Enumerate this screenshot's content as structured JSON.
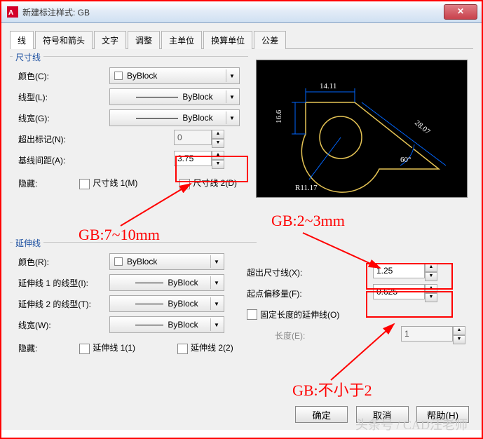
{
  "window": {
    "title": "新建标注样式: GB"
  },
  "tabs": [
    "线",
    "符号和箭头",
    "文字",
    "调整",
    "主单位",
    "换算单位",
    "公差"
  ],
  "dim_lines": {
    "group": "尺寸线",
    "color_label": "颜色(C):",
    "color_value": "ByBlock",
    "linetype_label": "线型(L):",
    "linetype_value": "ByBlock",
    "lineweight_label": "线宽(G):",
    "lineweight_value": "ByBlock",
    "ext_beyond_ticks_label": "超出标记(N):",
    "ext_beyond_ticks_value": "0",
    "baseline_spacing_label": "基线间距(A):",
    "baseline_spacing_value": "3.75",
    "suppress_label": "隐藏:",
    "suppress1": "尺寸线 1(M)",
    "suppress2": "尺寸线 2(D)"
  },
  "ext_lines": {
    "group": "延伸线",
    "color_label": "颜色(R):",
    "color_value": "ByBlock",
    "linetype1_label": "延伸线 1 的线型(I):",
    "linetype1_value": "ByBlock",
    "linetype2_label": "延伸线 2 的线型(T):",
    "linetype2_value": "ByBlock",
    "lineweight_label": "线宽(W):",
    "lineweight_value": "ByBlock",
    "suppress_label": "隐藏:",
    "suppress1": "延伸线 1(1)",
    "suppress2": "延伸线 2(2)",
    "ext_beyond_dim_label": "超出尺寸线(X):",
    "ext_beyond_dim_value": "1.25",
    "offset_origin_label": "起点偏移量(F):",
    "offset_origin_value": "0.625",
    "fixed_len_label": "固定长度的延伸线(O)",
    "length_label": "长度(E):",
    "length_value": "1"
  },
  "buttons": {
    "ok": "确定",
    "cancel": "取消",
    "help": "帮助(H)"
  },
  "annotations": {
    "baseline_note": "GB:7~10mm",
    "ext_beyond_note": "GB:2~3mm",
    "offset_note": "GB:不小于2"
  },
  "preview_dims": {
    "top": "14.11",
    "left": "16.6",
    "radius": "R11.17",
    "angle": "60°",
    "slant": "28.07"
  },
  "watermark": "头条号 / CAD汪老师"
}
